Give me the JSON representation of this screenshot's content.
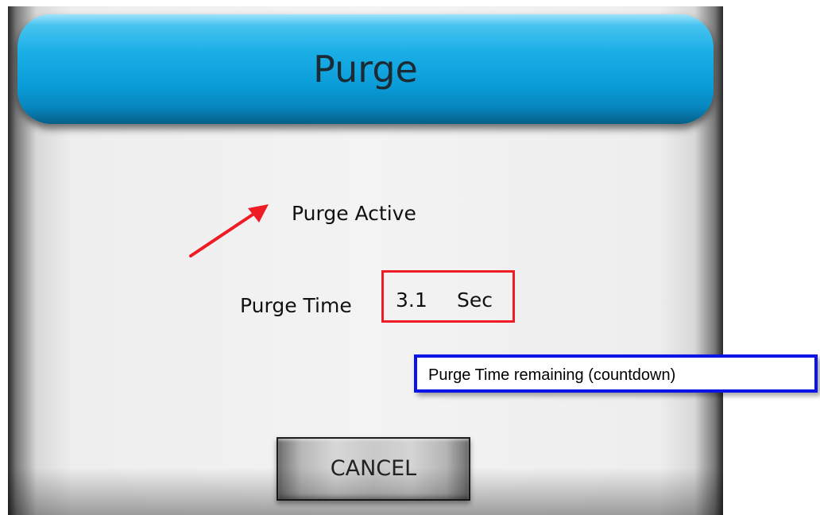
{
  "dialog": {
    "title": "Purge",
    "status_text": "Purge Active",
    "purge_time_label": "Purge Time",
    "purge_time_value": "3.1",
    "purge_time_unit": "Sec",
    "cancel_label": "CANCEL"
  },
  "annotations": {
    "callout_text": "Purge Time remaining (countdown)",
    "arrow_color": "#ee1c24",
    "highlight_box_color": "#ee1c24",
    "callout_border_color": "#0a14e8"
  },
  "colors": {
    "title_bar": "#0a9cd8",
    "panel_background": "#f3f3f3",
    "button_face": "#c9c9c9"
  }
}
